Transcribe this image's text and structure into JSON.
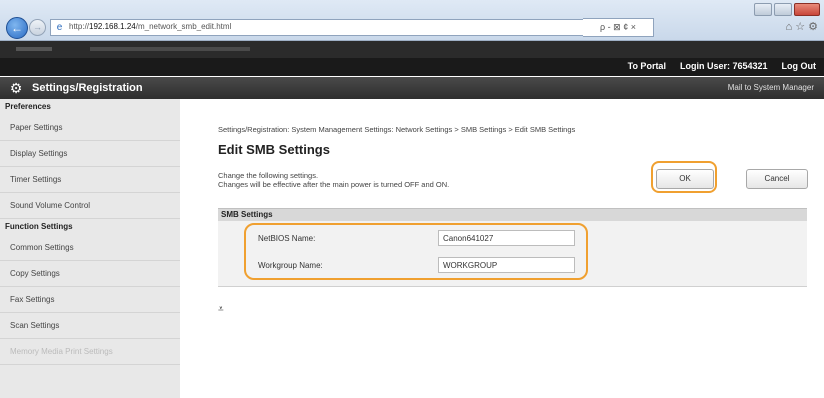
{
  "browser": {
    "url_prefix": "http://",
    "url_host": "192.168.1.24",
    "url_path": "/m_network_smb_edit.html",
    "search_symbols": "ρ - ⊠ ¢ ×",
    "right_icons": "⌂ ☆ ⚙"
  },
  "topbar": {
    "to_portal": "To Portal",
    "login_user": "Login User: 7654321",
    "log_out": "Log Out"
  },
  "header": {
    "title": "Settings/Registration",
    "mail": "Mail to System Manager"
  },
  "sidebar": {
    "preferences_heading": "Preferences",
    "preferences_items": [
      {
        "label": "Paper Settings"
      },
      {
        "label": "Display Settings"
      },
      {
        "label": "Timer Settings"
      },
      {
        "label": "Sound Volume Control"
      }
    ],
    "function_heading": "Function Settings",
    "function_items": [
      {
        "label": "Common Settings"
      },
      {
        "label": "Copy Settings"
      },
      {
        "label": "Fax Settings"
      },
      {
        "label": "Scan Settings"
      },
      {
        "label": "Memory Media Print Settings"
      }
    ]
  },
  "main": {
    "breadcrumb": "Settings/Registration: System Management Settings: Network Settings > SMB Settings > Edit SMB Settings",
    "title": "Edit SMB Settings",
    "instruction1": "Change the following settings.",
    "instruction2": "Changes will be effective after the main power is turned OFF and ON.",
    "ok_label": "OK",
    "cancel_label": "Cancel",
    "section_title": "SMB Settings",
    "fields": [
      {
        "label": "NetBIOS Name:",
        "value": "Canon641027"
      },
      {
        "label": "Workgroup Name:",
        "value": "WORKGROUP"
      }
    ],
    "top_link": "⩡"
  },
  "colors": {
    "highlight": "#f0a030",
    "header_bg": "#2e2e2e",
    "sidebar_bg": "#e8e8e8"
  }
}
